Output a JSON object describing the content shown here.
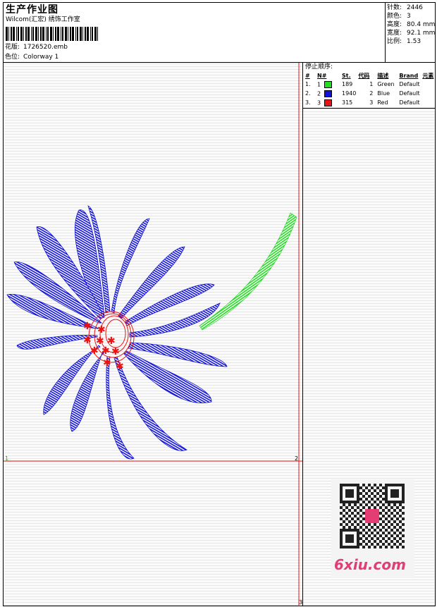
{
  "header": {
    "title": "生产作业图",
    "company": "Wilcom(汇宏) 绣饰工作室",
    "design_label": "花版:",
    "design_file": "1726520.emb",
    "colorway_label": "色位:",
    "colorway": "Colorway 1"
  },
  "stats": [
    {
      "label": "针数:",
      "value": "2446"
    },
    {
      "label": "颜色:",
      "value": "3"
    },
    {
      "label": "高度:",
      "value": "80.4 mm"
    },
    {
      "label": "宽度:",
      "value": "92.1 mm"
    },
    {
      "label": "比例:",
      "value": "1.53"
    }
  ],
  "stop_sequence": {
    "title": "停止顺序:",
    "headers": [
      "#",
      "N#",
      "St.",
      "代码",
      "描述",
      "Brand",
      "元素"
    ],
    "rows": [
      {
        "num": "1.",
        "n": "1",
        "color": "#22dd22",
        "st": "189",
        "code": "1",
        "desc": "Green",
        "brand": "Default"
      },
      {
        "num": "2.",
        "n": "2",
        "color": "#1111dd",
        "st": "1940",
        "code": "2",
        "desc": "Blue",
        "brand": "Default"
      },
      {
        "num": "3.",
        "n": "3",
        "color": "#ee1111",
        "st": "315",
        "code": "3",
        "desc": "Red",
        "brand": "Default"
      }
    ]
  },
  "markers": {
    "m1": "1",
    "m2": "2",
    "m3": "3"
  },
  "watermark": {
    "text": "6xiu.com",
    "color": "#e33d73"
  },
  "colors": {
    "green": "#22dd22",
    "blue": "#1111dd",
    "red": "#ee1111"
  }
}
